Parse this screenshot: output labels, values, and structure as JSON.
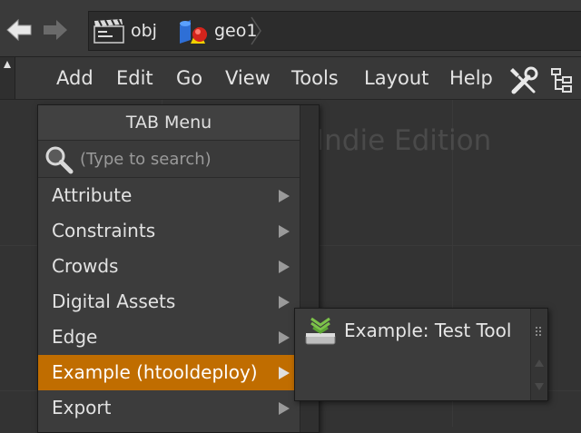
{
  "path": {
    "crumbs": [
      {
        "label": "obj",
        "icon": "scene-clapperboard-icon"
      },
      {
        "label": "geo1",
        "icon": "geometry-shapes-icon"
      }
    ]
  },
  "toolbar": {
    "menus": [
      "Add",
      "Edit",
      "Go",
      "View",
      "Tools",
      "Layout",
      "Help"
    ],
    "icons": [
      "wrench-screwdriver-icon",
      "tree-view-icon"
    ]
  },
  "canvas": {
    "watermark": "Indie Edition"
  },
  "tab_menu": {
    "title": "TAB Menu",
    "search_placeholder": "(Type to search)",
    "items": [
      {
        "label": "Attribute"
      },
      {
        "label": "Constraints"
      },
      {
        "label": "Crowds"
      },
      {
        "label": "Digital Assets"
      },
      {
        "label": "Edge"
      },
      {
        "label": "Example (htooldeploy)",
        "selected": true
      },
      {
        "label": "Export"
      }
    ]
  },
  "submenu": {
    "items": [
      {
        "label": "Example: Test Tool",
        "icon": "tool-shelf-icon"
      }
    ]
  },
  "colors": {
    "background": "#333333",
    "selection": "#c06d00",
    "menu_bg": "#3c3c3c"
  }
}
